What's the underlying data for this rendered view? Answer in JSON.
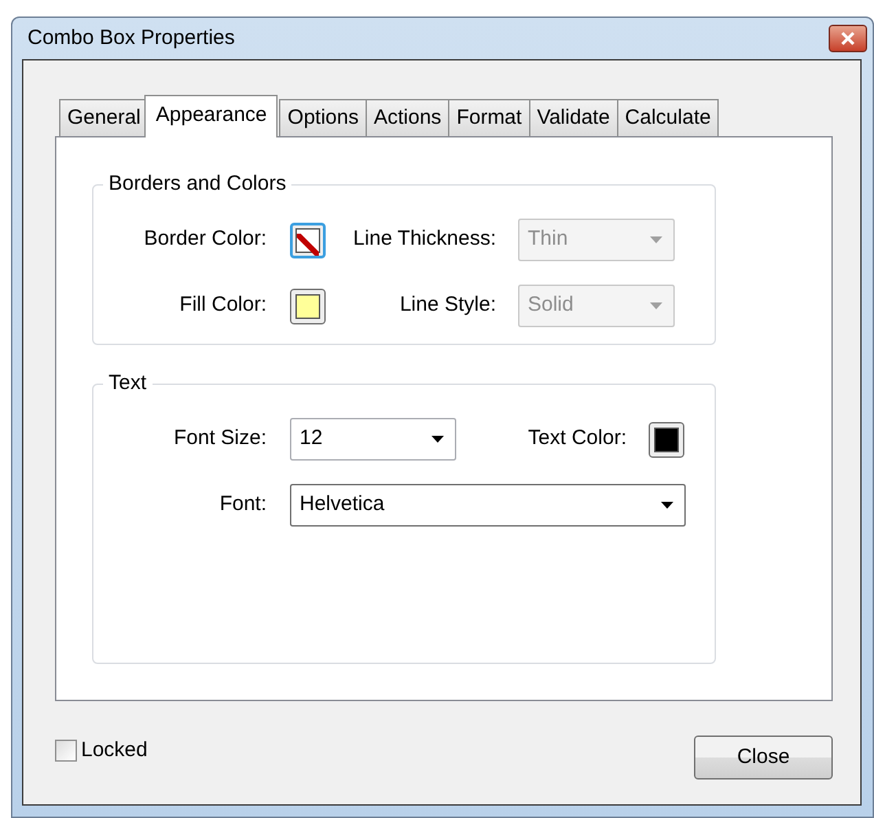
{
  "window": {
    "title": "Combo Box Properties"
  },
  "tabs": [
    {
      "label": "General",
      "selected": false
    },
    {
      "label": "Appearance",
      "selected": true
    },
    {
      "label": "Options",
      "selected": false
    },
    {
      "label": "Actions",
      "selected": false
    },
    {
      "label": "Format",
      "selected": false
    },
    {
      "label": "Validate",
      "selected": false
    },
    {
      "label": "Calculate",
      "selected": false
    }
  ],
  "groups": [
    {
      "title": "Borders and Colors",
      "rows": [
        {
          "fields": [
            {
              "kind": "no-color-swatch",
              "label": "Border Color:",
              "focused": true
            },
            {
              "kind": "select",
              "label": "Line Thickness:",
              "value": "Thin",
              "disabled": true
            }
          ]
        },
        {
          "fields": [
            {
              "kind": "swatch",
              "label": "Fill Color:",
              "color": "#ffff99",
              "focused": false
            },
            {
              "kind": "select",
              "label": "Line Style:",
              "value": "Solid",
              "disabled": true
            }
          ]
        }
      ]
    },
    {
      "title": "Text",
      "rows": [
        {
          "fields": [
            {
              "kind": "select",
              "label": "Font Size:",
              "value": "12",
              "disabled": false
            },
            {
              "kind": "swatch",
              "label": "Text Color:",
              "color": "#000000",
              "focused": false
            }
          ]
        },
        {
          "fields": [
            {
              "kind": "select",
              "label": "Font:",
              "value": "Helvetica",
              "disabled": false
            }
          ]
        }
      ]
    }
  ],
  "locked": {
    "label": "Locked",
    "checked": false
  },
  "close_button": {
    "label": "Close"
  }
}
